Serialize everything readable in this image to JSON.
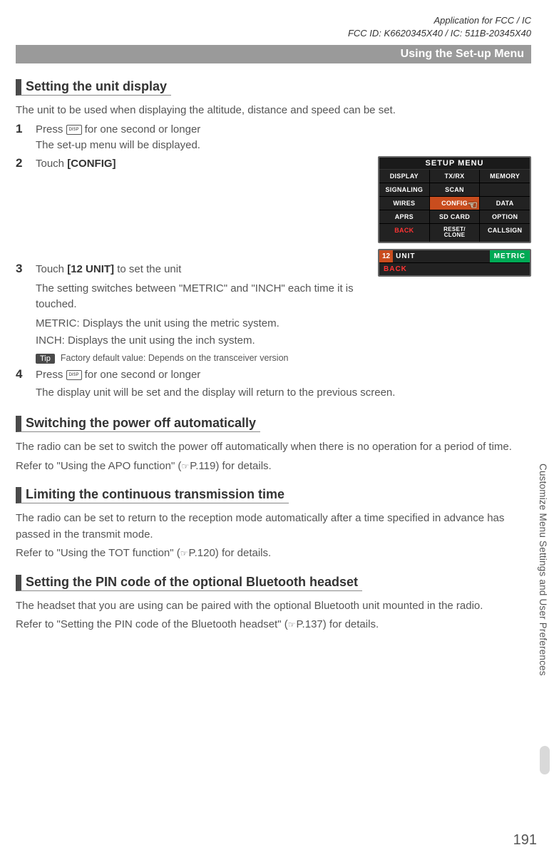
{
  "header": {
    "app_line1": "Application for FCC / IC",
    "app_line2": "FCC ID: K6620345X40 / IC: 511B-20345X40"
  },
  "breadcrumb": "Using the Set-up Menu",
  "side_label": "Customize Menu Settings and User Preferences",
  "page_number": "191",
  "sections": {
    "unit_display": {
      "title": "Setting the unit display",
      "intro": "The unit to be used when displaying the altitude, distance and speed can be set.",
      "step1_a": "Press ",
      "step1_b": " for one second or longer",
      "step1_sub": "The set-up menu will be displayed.",
      "step2": "Touch ",
      "step2_bold": "[CONFIG]",
      "step3": "Touch ",
      "step3_bold": "[12 UNIT]",
      "step3_rest": " to set the unit",
      "step3_sub1": "The setting switches between \"METRIC\" and \"INCH\" each time it is touched.",
      "step3_sub2": "METRIC: Displays the unit using the metric system.",
      "step3_sub3": "INCH: Displays the unit using the inch system.",
      "tip_label": "Tip",
      "tip_text": "Factory default value: Depends on the transceiver version",
      "step4_a": "Press ",
      "step4_b": " for one second or longer",
      "step4_sub": "The display unit will be set and the display will return to the previous screen."
    },
    "apo": {
      "title": "Switching the power off automatically",
      "p1": "The radio can be set to switch the power off automatically when there is no operation for a period of time.",
      "p2a": "Refer to \"Using the APO function\" (",
      "p2b": "P.119) for details."
    },
    "tot": {
      "title": "Limiting the continuous transmission time",
      "p1": "The radio can be set to return to the reception mode automatically after a time specified in advance has passed in the transmit mode.",
      "p2a": "Refer to \"Using the TOT function\" (",
      "p2b": "P.120) for details."
    },
    "pin": {
      "title": "Setting the PIN code of the optional Bluetooth headset",
      "p1": "The headset that you are using can be paired with the optional Bluetooth unit mounted in the radio.",
      "p2a": "Refer to \"Setting the PIN code of the Bluetooth headset\" (",
      "p2b": "P.137) for details."
    }
  },
  "screen1": {
    "title": "SETUP MENU",
    "cells": [
      "DISPLAY",
      "TX/RX",
      "MEMORY",
      "SIGNALING",
      "SCAN",
      "",
      "WIRES",
      "CONFIG",
      "DATA",
      "APRS",
      "SD CARD",
      "OPTION",
      "BACK",
      "RESET/\nCLONE",
      "CALLSIGN"
    ]
  },
  "screen2": {
    "num": "12",
    "label": "UNIT",
    "value": "METRIC",
    "back": "BACK"
  },
  "icons": {
    "disp": "DISP",
    "pointer": "☞"
  }
}
